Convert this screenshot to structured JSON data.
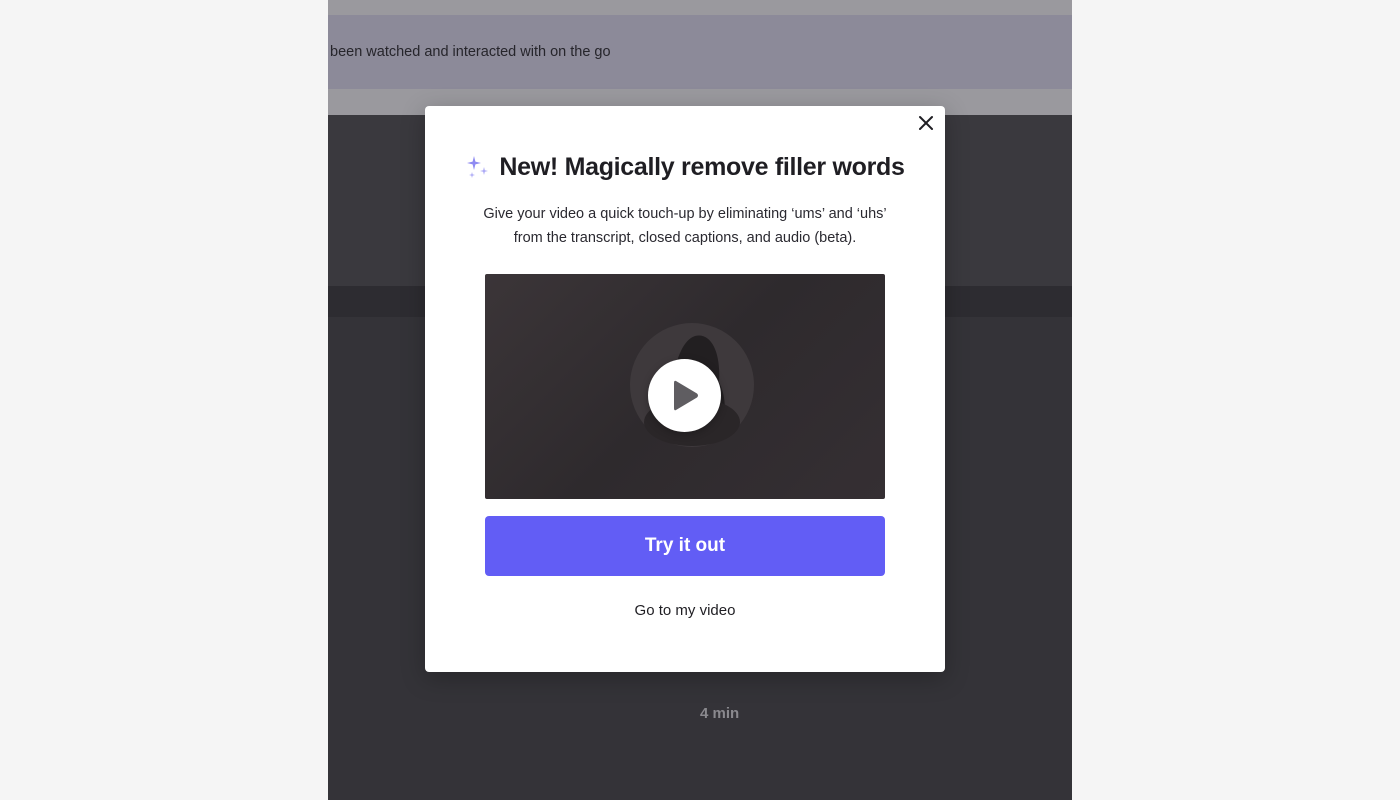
{
  "background": {
    "banner_text": "been watched and interacted with on the go",
    "duration": "4 min"
  },
  "modal": {
    "title": "New! Magically remove filler words",
    "title_icon": "sparkle-icon",
    "description": "Give your video a quick touch-up by eliminating ‘ums’ and ‘uhs’ from the transcript, closed captions, and audio (beta).",
    "close_icon": "close-icon",
    "video": {
      "play_icon": "play-icon"
    },
    "primary_button_label": "Try it out",
    "secondary_link_label": "Go to my video"
  },
  "colors": {
    "accent": "#625df5",
    "sparkle": "#8f8bf2",
    "overlay_dark": "#343338",
    "banner": "#8c8a99"
  }
}
